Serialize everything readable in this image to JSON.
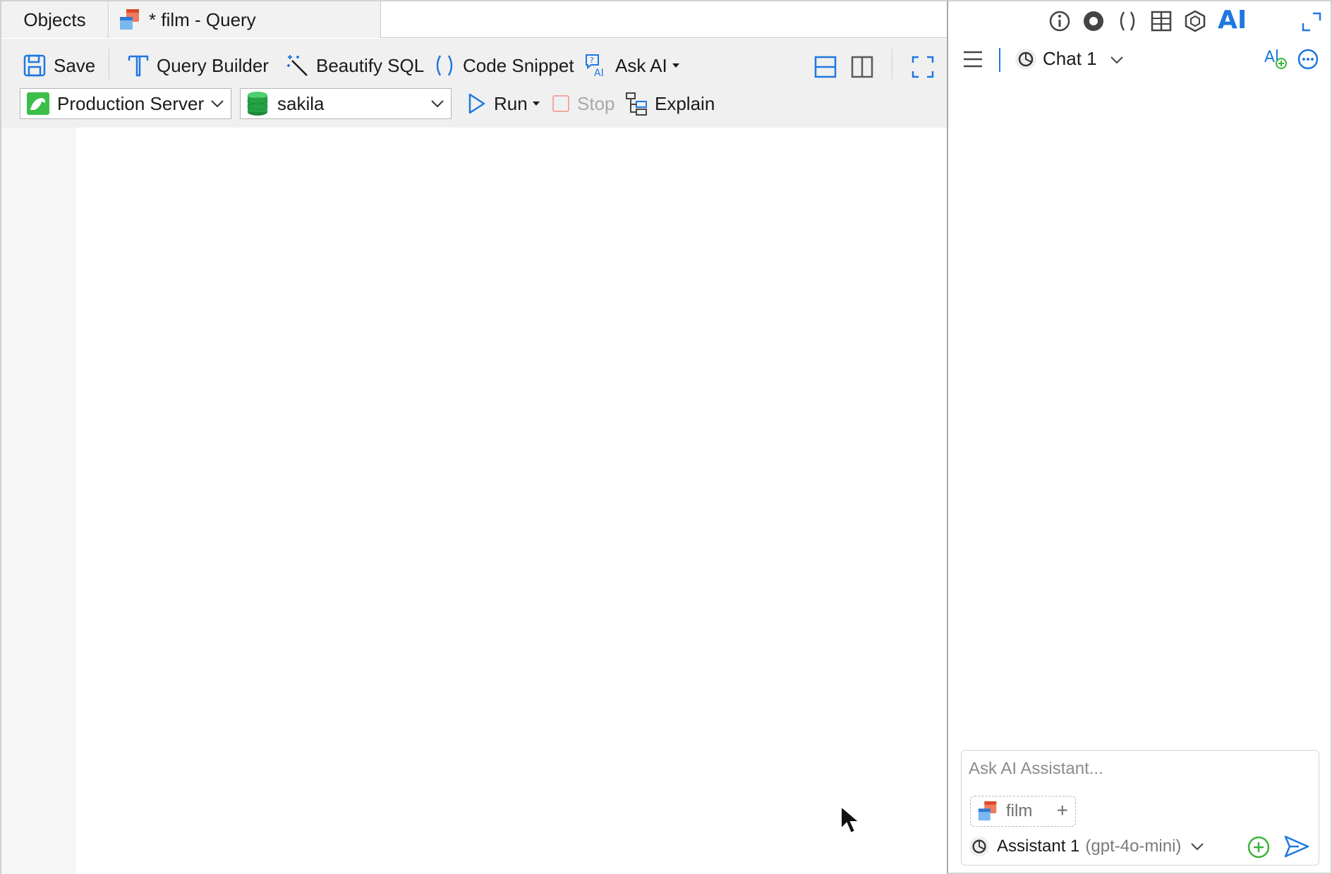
{
  "tabs": {
    "objects_label": "Objects",
    "query_label": "* film - Query"
  },
  "toolbar": {
    "save_label": "Save",
    "query_builder_label": "Query Builder",
    "beautify_label": "Beautify SQL",
    "snippet_label": "Code Snippet",
    "ask_ai_label": "Ask AI",
    "run_label": "Run",
    "stop_label": "Stop",
    "explain_label": "Explain",
    "connection_value": "Production Server",
    "database_value": "sakila"
  },
  "ai_panel": {
    "ai_title": "AI",
    "chat_title": "Chat 1",
    "input_placeholder": "Ask AI Assistant...",
    "context_chip_label": "film",
    "context_chip_add": "+",
    "assistant_name": "Assistant 1",
    "assistant_model": "(gpt-4o-mini)"
  },
  "colors": {
    "accent": "#1e78e0",
    "green_add": "#3bb33b",
    "toolbar_bg": "#f0f0f0"
  },
  "icons": [
    "save-icon",
    "query-builder-icon",
    "beautify-icon",
    "snippet-icon",
    "ask-ai-icon",
    "run-icon",
    "stop-icon",
    "explain-icon",
    "split-horizontal-icon",
    "split-vertical-icon",
    "fullscreen-icon",
    "info-icon",
    "eye-icon",
    "parens-icon",
    "grid-icon",
    "hexagon-icon",
    "expand-icon",
    "menu-icon",
    "openai-icon",
    "new-chat-icon",
    "more-icon",
    "table-icon",
    "add-context-icon",
    "send-icon",
    "mysql-icon",
    "database-icon",
    "cursor-icon"
  ]
}
